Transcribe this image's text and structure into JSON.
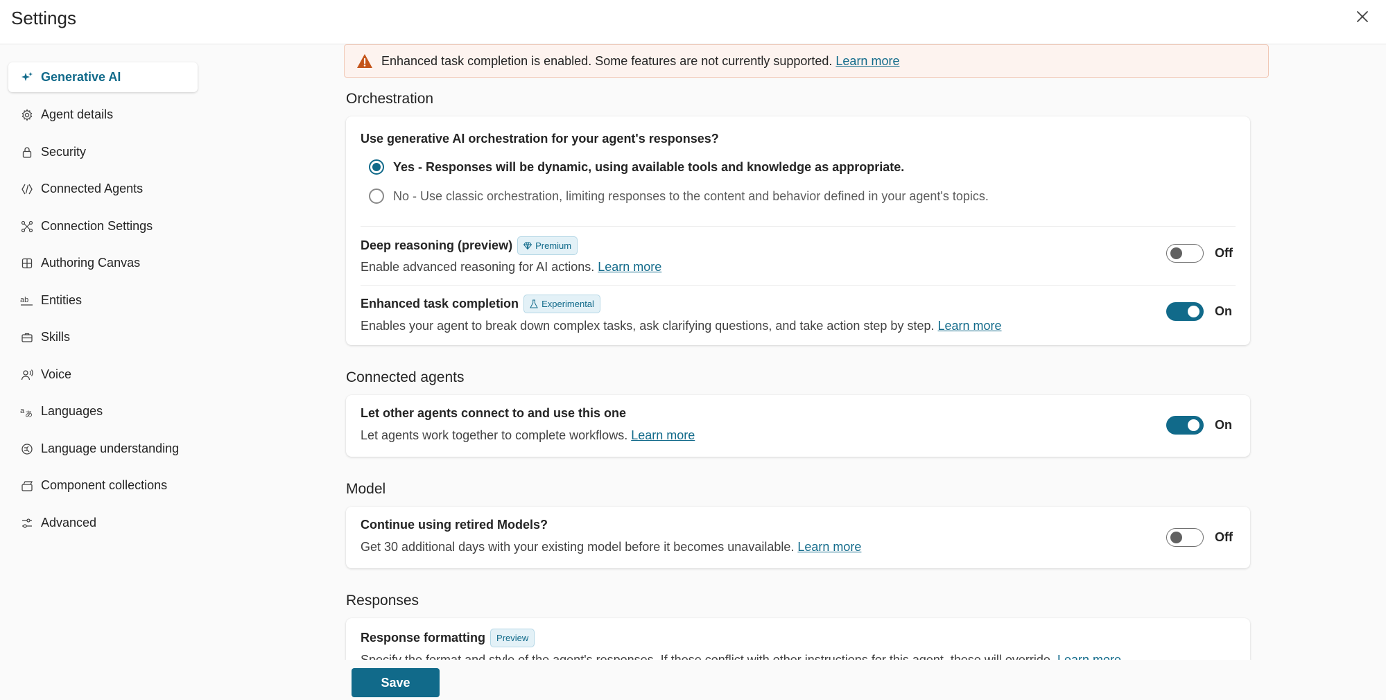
{
  "header": {
    "title": "Settings",
    "close_icon": "close-icon"
  },
  "sidebar": {
    "items": [
      {
        "label": "Generative AI",
        "icon": "sparkle-icon",
        "active": true
      },
      {
        "label": "Agent details",
        "icon": "gear-icon"
      },
      {
        "label": "Security",
        "icon": "lock-icon"
      },
      {
        "label": "Connected Agents",
        "icon": "connected-agents-icon"
      },
      {
        "label": "Connection Settings",
        "icon": "connection-icon"
      },
      {
        "label": "Authoring Canvas",
        "icon": "grid-icon"
      },
      {
        "label": "Entities",
        "icon": "text-ab-icon"
      },
      {
        "label": "Skills",
        "icon": "briefcase-icon"
      },
      {
        "label": "Voice",
        "icon": "voice-icon"
      },
      {
        "label": "Languages",
        "icon": "translate-icon"
      },
      {
        "label": "Language understanding",
        "icon": "brain-circuit-icon"
      },
      {
        "label": "Component collections",
        "icon": "collection-icon"
      },
      {
        "label": "Advanced",
        "icon": "sliders-icon"
      }
    ]
  },
  "banner": {
    "text": "Enhanced task completion is enabled. Some features are not currently supported.",
    "link": "Learn more",
    "icon": "warning-icon"
  },
  "orchestration": {
    "section_title": "Orchestration",
    "question": "Use generative AI orchestration for your agent's responses?",
    "options": [
      {
        "label": "Yes - Responses will be dynamic, using available tools and knowledge as appropriate.",
        "selected": true
      },
      {
        "label": "No - Use classic orchestration, limiting responses to the content and behavior defined in your agent's topics.",
        "selected": false
      }
    ],
    "deep_reasoning": {
      "title": "Deep reasoning (preview)",
      "badge": "Premium",
      "badge_icon": "diamond-icon",
      "desc": "Enable advanced reasoning for AI actions.",
      "link": "Learn more",
      "state": "Off"
    },
    "enhanced_task": {
      "title": "Enhanced task completion",
      "badge": "Experimental",
      "badge_icon": "beaker-icon",
      "desc": "Enables your agent to break down complex tasks, ask clarifying questions, and take action step by step.",
      "link": "Learn more",
      "state": "On"
    }
  },
  "connected_agents": {
    "section_title": "Connected agents",
    "title": "Let other agents connect to and use this one",
    "desc": "Let agents work together to complete workflows.",
    "link": "Learn more",
    "state": "On"
  },
  "model": {
    "section_title": "Model",
    "title": "Continue using retired Models?",
    "desc": "Get 30 additional days with your existing model before it becomes unavailable.",
    "link": "Learn more",
    "state": "Off"
  },
  "responses": {
    "section_title": "Responses",
    "title": "Response formatting",
    "badge": "Preview",
    "desc": "Specify the format and style of the agent's responses. If these conflict with other instructions for this agent, these will override.",
    "link": "Learn more"
  },
  "footer": {
    "save_label": "Save"
  },
  "colors": {
    "accent": "#116a8a",
    "warning": "#c4541a",
    "banner_bg": "#fdf3ef"
  }
}
